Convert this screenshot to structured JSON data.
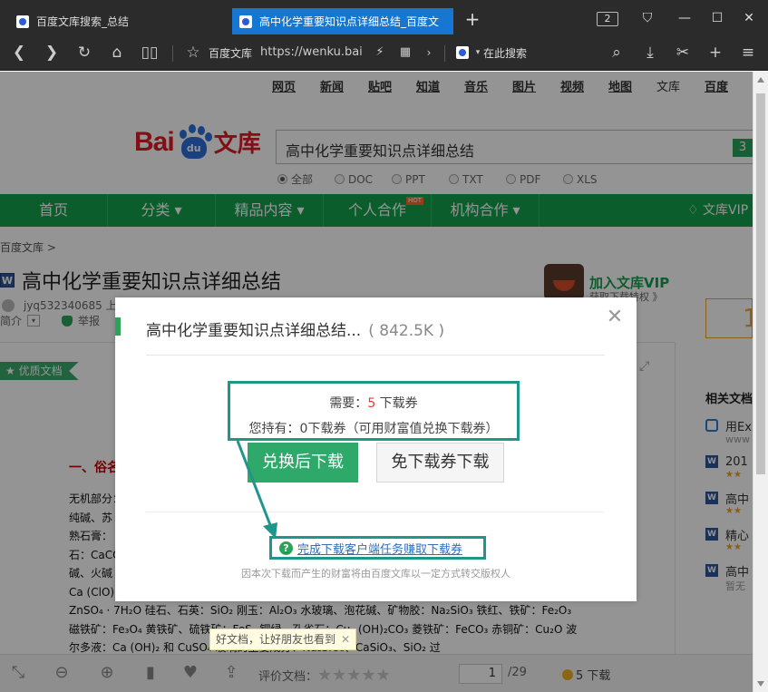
{
  "tabs": [
    {
      "title": "百度文库搜索_总结",
      "active": false
    },
    {
      "title": "高中化学重要知识点详细总结_百度文",
      "active": true
    }
  ],
  "tab_count": "2",
  "address": {
    "site_name": "百度文库",
    "url": "https://wenku.bai",
    "search_placeholder": "在此搜索"
  },
  "top_links": [
    "网页",
    "新闻",
    "贴吧",
    "知道",
    "音乐",
    "图片",
    "视频",
    "地图",
    "文库",
    "百度"
  ],
  "logo": {
    "bai": "Bai",
    "du": "du",
    "wenku": "文库"
  },
  "search": {
    "query": "高中化学重要知识点详细总结",
    "count": "3"
  },
  "filters": [
    "全部",
    "DOC",
    "PPT",
    "TXT",
    "PDF",
    "XLS"
  ],
  "main_nav": [
    {
      "label": "首页"
    },
    {
      "label": "分类 ▾"
    },
    {
      "label": "精品内容 ▾"
    },
    {
      "label": "个人合作"
    },
    {
      "label": "机构合作 ▾"
    }
  ],
  "hot_badge": "HOT",
  "vip_nav": "文库VIP",
  "breadcrumb": "百度文库 >",
  "doc": {
    "title": "高中化学重要知识点详细总结",
    "uploader": "jyq532340685 上",
    "intro": "简介",
    "report": "举报",
    "quality_badge": "优质文档",
    "heading": "一、俗名",
    "lines": [
      "无机部分：",
      "纯碱、苏",
      "熟石膏：",
      "石：CaCO",
      "碱、火碱",
      "Ca (ClO)",
      "ZnSO₄ · 7H₂O    硅石、石英：SiO₂    刚玉：Al₂O₃    水玻璃、泡花碱、矿物胶：Na₂SiO₃    铁红、铁矿：Fe₂O₃",
      "磁铁矿：Fe₃O₄    黄铁矿、硫铁矿：FeS₂    铜绿、孔雀石：Cu₂ (OH)₂CO₃    菱铁矿：FeCO₃    赤铜矿：Cu₂O    波",
      "尔多液：Ca (OH)₂ 和 CuSO₄                         玻璃的主要成分：Na₂SiO₃、CaSiO₃、SiO₂    过"
    ]
  },
  "vip_promo": {
    "title": "加入文库VIP",
    "subtitle": "获取下载特权 》"
  },
  "side_number": "1",
  "sidebar": {
    "heading": "相关文档",
    "items": [
      {
        "label": "用Ex",
        "sub": "www"
      },
      {
        "label": "201",
        "stars": "★★"
      },
      {
        "label": "高中",
        "stars": "★★"
      },
      {
        "label": "精心",
        "stars": "★★"
      },
      {
        "label": "高中",
        "sub": "暂无"
      }
    ]
  },
  "dialog": {
    "title": "高中化学重要知识点详细总结...",
    "size": "( 842.5K )",
    "need_label": "需要：",
    "need_num": "5",
    "need_unit": " 下载券",
    "have_text": "您持有：0下载券（可用财富值兑换下载券）",
    "exchange_button": "兑换后下载",
    "free_button": "免下载券下载",
    "task_link": "完成下载客户端任务赚取下载券",
    "note": "因本次下载而产生的财富将由百度文库以一定方式转交版权人"
  },
  "bottom": {
    "share_tip": "好文档，让好朋友也看到",
    "rate_label": "评价文档：",
    "rate_stars": "★★★★★",
    "page_current": "1",
    "page_total": "/29",
    "download": "5 下载"
  }
}
